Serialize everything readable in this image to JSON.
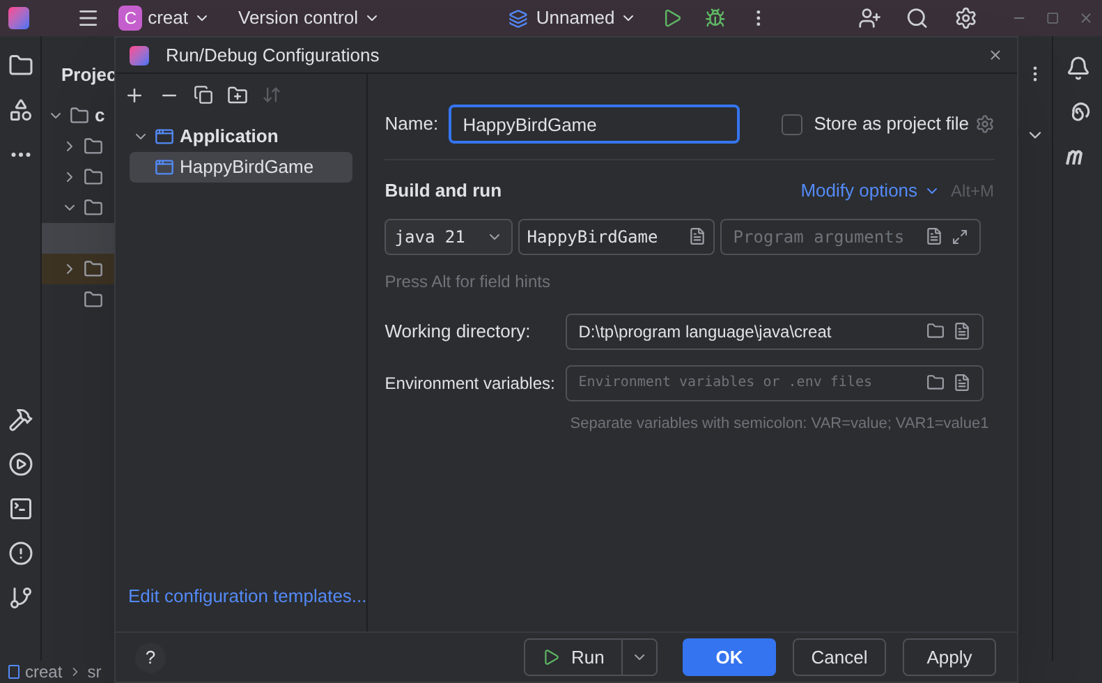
{
  "ide_toolbar": {
    "project_letter": "C",
    "project_name": "creat",
    "vcs": "Version control",
    "run_config": "Unnamed"
  },
  "project_panel": {
    "title": "Projec",
    "tree": [
      {
        "label": "c",
        "expanded": true,
        "selected": false,
        "children": [
          {
            "expanded": false,
            "selected": false,
            "marked": false
          },
          {
            "expanded": false,
            "selected": false,
            "marked": false
          },
          {
            "expanded": true,
            "selected": false,
            "marked": false,
            "children": [
              {
                "selected": true,
                "marked": false
              }
            ]
          },
          {
            "expanded": false,
            "selected": false,
            "marked": true
          },
          {
            "selected": false,
            "marked": false
          }
        ]
      }
    ]
  },
  "dialog": {
    "title": "Run/Debug Configurations",
    "config_tree": [
      {
        "label": "Application",
        "expanded": true,
        "selected": false,
        "children": [
          {
            "label": "HappyBirdGame",
            "selected": true
          }
        ]
      }
    ],
    "help": "?",
    "edit_templates_link": "Edit configuration templates...",
    "name_label": "Name:",
    "name_value": "HappyBirdGame",
    "store_checkbox": {
      "label": "Store as project file",
      "checked": false
    },
    "section_title": "Build and run",
    "modify_options": "Modify options",
    "modify_shortcut": "Alt+M",
    "jdk": "java 21",
    "main_class": "HappyBirdGame",
    "program_args_placeholder": "Program arguments",
    "field_hint": "Press Alt for field hints",
    "working_dir_label": "Working directory:",
    "working_dir_value": "D:\\tp\\program language\\java\\creat",
    "env_label": "Environment variables:",
    "env_placeholder": "Environment variables or .env files",
    "env_hint": "Separate variables with semicolon: VAR=value; VAR1=value1",
    "buttons": [
      {
        "label": "Run",
        "kind": "split"
      },
      {
        "label": "OK",
        "kind": "primary"
      },
      {
        "label": "Cancel",
        "kind": "normal"
      },
      {
        "label": "Apply",
        "kind": "normal"
      }
    ]
  },
  "status_bar": {
    "breadcrumb": [
      "creat",
      "sr"
    ]
  }
}
